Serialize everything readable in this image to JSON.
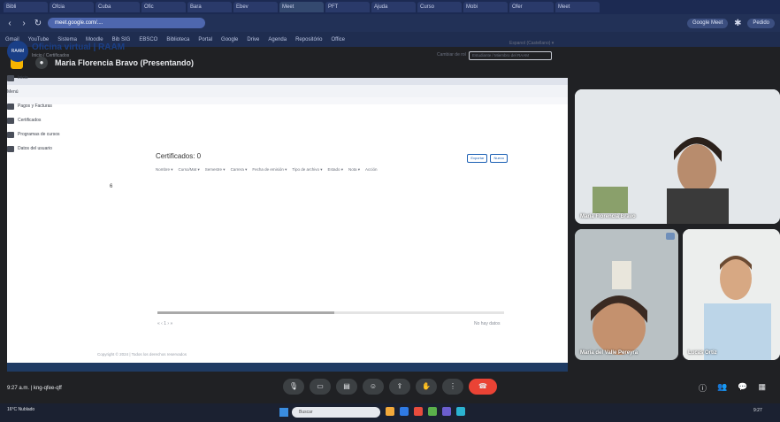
{
  "browser": {
    "tabs": [
      "Bibli",
      "Ofcia",
      "Cuba",
      "Ofic",
      "Bara",
      "Ebev",
      "Meet",
      "PFT",
      "Ajuda",
      "Curso",
      "Mobi",
      "Ofer",
      "Meet"
    ],
    "omnibox_url": "meet.google.com/....",
    "profile_chip": "Google Meet",
    "account_chip": "Pedido",
    "bookmarks": [
      "Gmail",
      "YouTube",
      "Sistema",
      "Moodle",
      "Bib SIG",
      "EBSCO",
      "Biblioteca",
      "Portal",
      "Google",
      "Drive",
      "Agenda",
      "Repositório",
      "Office"
    ]
  },
  "meet": {
    "presenter_label": "Maria Florencia Bravo (Presentando)",
    "clock": "9:27 a.m. | kng-qfee-qff",
    "participants": [
      {
        "name": "María Florencia Bravo"
      },
      {
        "name": "María del Valle Pereyra"
      },
      {
        "name": "Lucas Ortiz"
      }
    ],
    "controls": [
      "mic",
      "cam",
      "cc",
      "emoji",
      "present",
      "hand",
      "more",
      "leave"
    ],
    "right_controls": [
      "info",
      "people",
      "chat",
      "activities"
    ]
  },
  "shared": {
    "site_title": "Oficina virtual | RAAM",
    "site_sub": "Inicio / Certificados",
    "lang": "Espanol (Castellano) ▾",
    "search_label": "Cambiar de rol",
    "search_value": "Estudiante / Miembro del RAAM",
    "nav": [
      "Inicio",
      "Menú",
      "Pagos y Facturas",
      "Certificados",
      "Programas de cursos",
      "Datos del usuario"
    ],
    "content_num": "6",
    "card_title": "Certificados: 0",
    "columns": [
      "Nombre ▾",
      "Curso/Mat ▾",
      "Semestre ▾",
      "Carrera ▾",
      "Fecha de emisión ▾",
      "Tipo de archivo ▾",
      "Estado ▾",
      "Nota ▾",
      "Acción"
    ],
    "buttons": [
      "Exportar",
      "Nuevo"
    ],
    "pager": "« ‹ 1 › »",
    "rows": "No hay datos",
    "footer": "Copyright © 2024 | Todos los derechos reservados"
  },
  "windows": {
    "weather": "16°C Nublado",
    "search_placeholder": "Buscar",
    "time": "9:27"
  }
}
